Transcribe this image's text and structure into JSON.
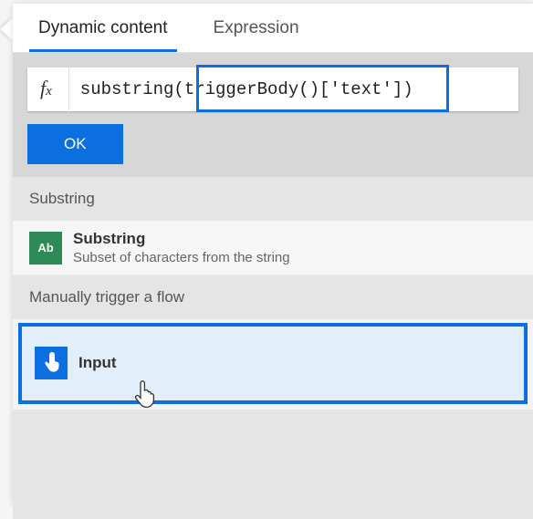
{
  "tabs": {
    "dynamic": "Dynamic content",
    "expression": "Expression"
  },
  "formula": {
    "fx_f": "f",
    "fx_x": "x",
    "prefix": "substrin",
    "highlight": "g(triggerBody()['text'])"
  },
  "buttons": {
    "ok": "OK"
  },
  "sections": {
    "substring": {
      "header": "Substring",
      "items": [
        {
          "icon": "Ab",
          "title": "Substring",
          "subtitle": "Subset of characters from the string"
        }
      ]
    },
    "trigger": {
      "header": "Manually trigger a flow",
      "items": [
        {
          "title": "Input"
        }
      ]
    }
  }
}
